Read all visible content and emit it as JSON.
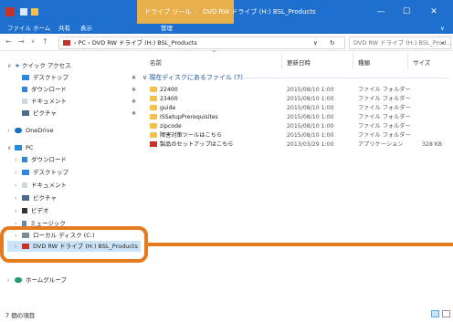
{
  "titlebar": {
    "tool_tab": "ドライブ ツール",
    "title": "DVD RW ドライブ (H:) BSL_Products",
    "minimize": "—",
    "maximize": "☐",
    "close": "✕"
  },
  "ribbon": {
    "tabs": [
      "ファイル",
      "ホーム",
      "共有",
      "表示",
      "管理"
    ],
    "expand": "∨"
  },
  "address": {
    "back": "←",
    "forward": "→",
    "recent": "∨",
    "up": "↑",
    "path": "› PC › DVD RW ドライブ (H:) BSL_Products",
    "refresh": "↻",
    "search_placeholder": "DVD RW ドライブ (H:) BSL_Prod...",
    "search_icon": "⌕"
  },
  "sidebar": {
    "quick_access": "クイック アクセス",
    "quick_items": [
      "デスクトップ",
      "ダウンロード",
      "ドキュメント",
      "ピクチャ"
    ],
    "onedrive": "OneDrive",
    "pc": "PC",
    "pc_items": [
      "ダウンロード",
      "デスクトップ",
      "ドキュメント",
      "ピクチャ",
      "ビデオ",
      "ミュージック",
      "ローカル ディスク (C:)",
      "DVD RW ドライブ (H:) BSL_Products"
    ],
    "homegroup": "ホームグループ"
  },
  "columns": {
    "name": "名前",
    "date": "更新日時",
    "type": "種類",
    "size": "サイズ"
  },
  "group_header": "現在ディスクにあるファイル (7)",
  "files": [
    {
      "name": "22400",
      "date": "2015/08/10 1:00",
      "type": "ファイル フォルダー",
      "size": ""
    },
    {
      "name": "23400",
      "date": "2015/08/10 1:00",
      "type": "ファイル フォルダー",
      "size": ""
    },
    {
      "name": "guide",
      "date": "2015/08/10 1:00",
      "type": "ファイル フォルダー",
      "size": ""
    },
    {
      "name": "ISSetupPrerequisites",
      "date": "2015/08/10 1:00",
      "type": "ファイル フォルダー",
      "size": ""
    },
    {
      "name": "zipcode",
      "date": "2015/08/10 1:00",
      "type": "ファイル フォルダー",
      "size": ""
    },
    {
      "name": "障害対策ツールはこちら",
      "date": "2015/08/10 1:00",
      "type": "ファイル フォルダー",
      "size": ""
    },
    {
      "name": "製品のセットアップはこちら",
      "date": "2013/03/29 1:00",
      "type": "アプリケーション",
      "size": "328 KB"
    }
  ],
  "status": {
    "count": "7 個の項目"
  },
  "colors": {
    "titlebar": "#1f6fcf",
    "tool_tab": "#e8b04a",
    "highlight": "#e57a1f",
    "selection": "#cce4f7",
    "group_header": "#1c4f9c"
  }
}
